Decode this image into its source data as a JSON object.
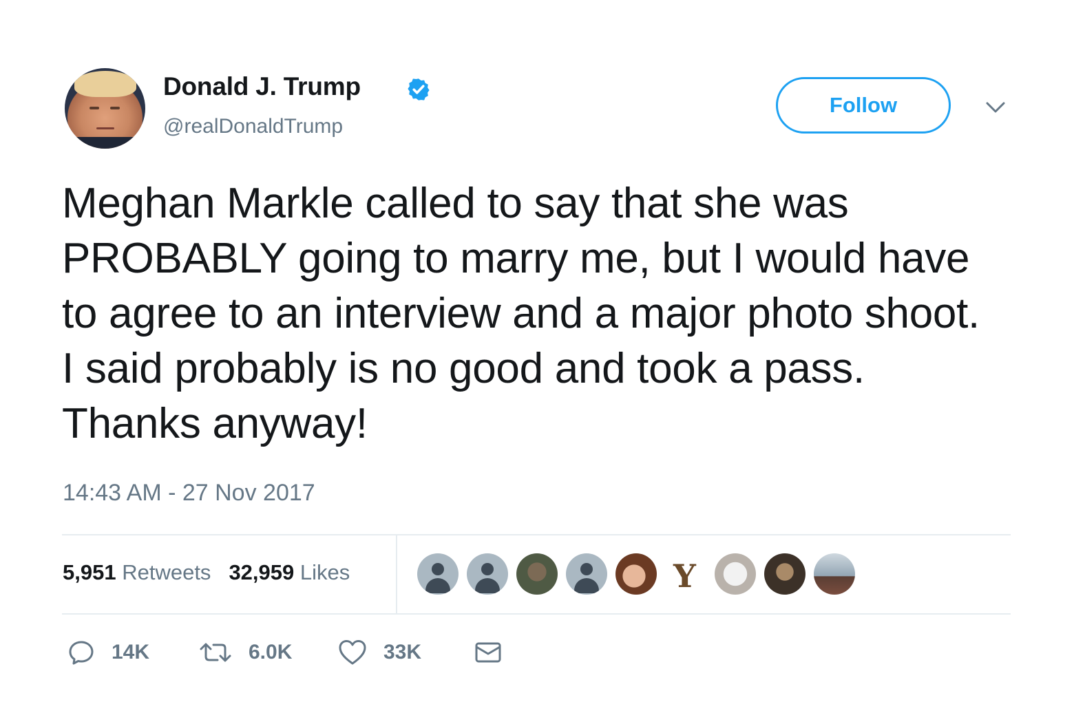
{
  "author": {
    "name": "Donald J. Trump",
    "handle": "@realDonaldTrump",
    "verified": true
  },
  "follow_button": {
    "label": "Follow"
  },
  "tweet": {
    "text": "Meghan Markle called to say that she was PROBABLY going to marry me, but I would have to agree to an interview and a major photo shoot. I said probably is no good and took a pass. Thanks anyway!",
    "timestamp": "14:43 AM - 27 Nov 2017"
  },
  "stats": {
    "retweets_count": "5,951",
    "retweets_label": "Retweets",
    "likes_count": "32,959",
    "likes_label": "Likes"
  },
  "likers": {
    "avatars": [
      "default-avatar",
      "default-avatar",
      "photo-avatar",
      "default-avatar",
      "photo-avatar",
      "photo-avatar",
      "photo-avatar",
      "photo-avatar",
      "photo-avatar"
    ]
  },
  "actions": {
    "reply_count": "14K",
    "retweet_count": "6.0K",
    "like_count": "33K",
    "reply_icon": "reply-icon",
    "retweet_icon": "retweet-icon",
    "like_icon": "heart-icon",
    "dm_icon": "envelope-icon"
  },
  "colors": {
    "accent": "#1da1f2",
    "text": "#14171a",
    "secondary": "#657786",
    "divider": "#e6ecf0"
  }
}
